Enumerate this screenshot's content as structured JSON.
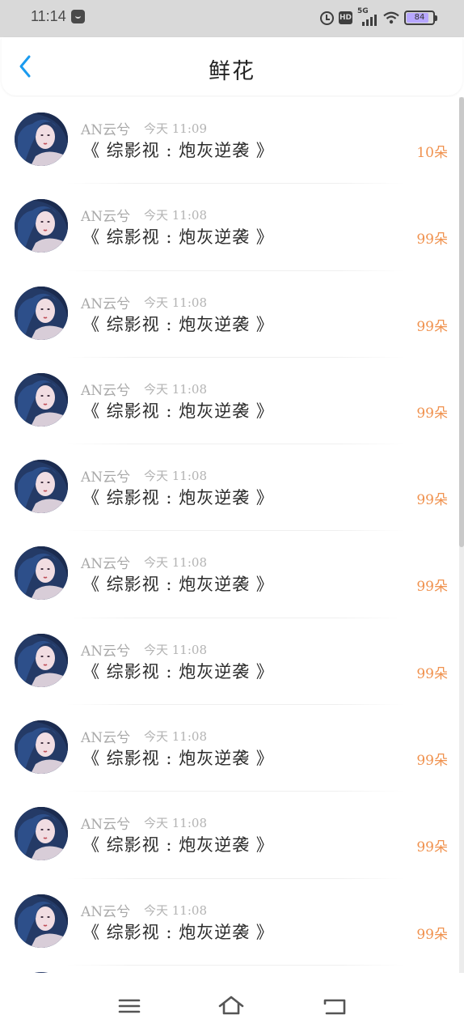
{
  "status_bar": {
    "time": "11:14",
    "network": "5G",
    "battery": "84",
    "icons": [
      "app-notification-icon",
      "alarm-icon",
      "hd-icon",
      "signal-icon",
      "wifi-icon",
      "battery-icon"
    ]
  },
  "header": {
    "title": "鲜花",
    "back_icon": "chevron-left-icon",
    "accent_color": "#1a9bef"
  },
  "gifts": [
    {
      "user": "AN云兮",
      "time": "今天 11:09",
      "work": "《 综影视 : 炮灰逆袭 》",
      "amount": "10朵"
    },
    {
      "user": "AN云兮",
      "time": "今天 11:08",
      "work": "《 综影视 : 炮灰逆袭 》",
      "amount": "99朵"
    },
    {
      "user": "AN云兮",
      "time": "今天 11:08",
      "work": "《 综影视 : 炮灰逆袭 》",
      "amount": "99朵"
    },
    {
      "user": "AN云兮",
      "time": "今天 11:08",
      "work": "《 综影视 : 炮灰逆袭 》",
      "amount": "99朵"
    },
    {
      "user": "AN云兮",
      "time": "今天 11:08",
      "work": "《 综影视 : 炮灰逆袭 》",
      "amount": "99朵"
    },
    {
      "user": "AN云兮",
      "time": "今天 11:08",
      "work": "《 综影视 : 炮灰逆袭 》",
      "amount": "99朵"
    },
    {
      "user": "AN云兮",
      "time": "今天 11:08",
      "work": "《 综影视 : 炮灰逆袭 》",
      "amount": "99朵"
    },
    {
      "user": "AN云兮",
      "time": "今天 11:08",
      "work": "《 综影视 : 炮灰逆袭 》",
      "amount": "99朵"
    },
    {
      "user": "AN云兮",
      "time": "今天 11:08",
      "work": "《 综影视 : 炮灰逆袭 》",
      "amount": "99朵"
    },
    {
      "user": "AN云兮",
      "time": "今天 11:08",
      "work": "《 综影视 : 炮灰逆袭 》",
      "amount": "99朵"
    }
  ],
  "colors": {
    "amount": "#f0924f",
    "username": "#a9a9a9",
    "title_text": "#2b2b2b"
  },
  "nav_bar": {
    "icons": [
      "menu-icon",
      "home-icon",
      "back-icon"
    ]
  }
}
